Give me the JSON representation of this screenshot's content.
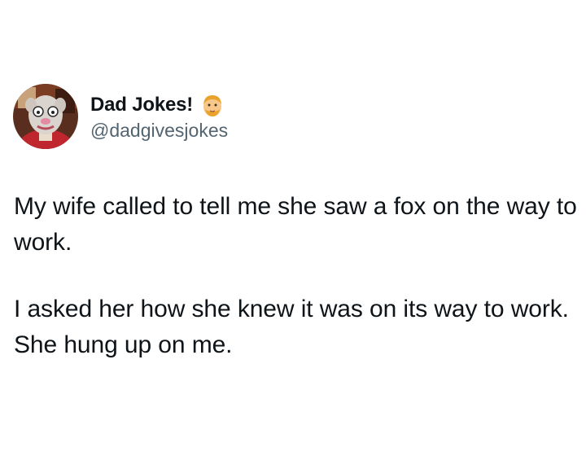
{
  "tweet": {
    "author": {
      "display_name": "Dad Jokes!",
      "handle": "@dadgivesjokes",
      "avatar_icon": "cartoon-dad-avatar",
      "badge_icon": "man-face-emoji"
    },
    "paragraphs": [
      "My wife called to tell me she saw a fox on the way to work.",
      "I asked her how she knew it was on its way to work. She hung up on me."
    ]
  },
  "colors": {
    "text": "#0f1419",
    "secondary_text": "#536471",
    "background": "#ffffff"
  }
}
